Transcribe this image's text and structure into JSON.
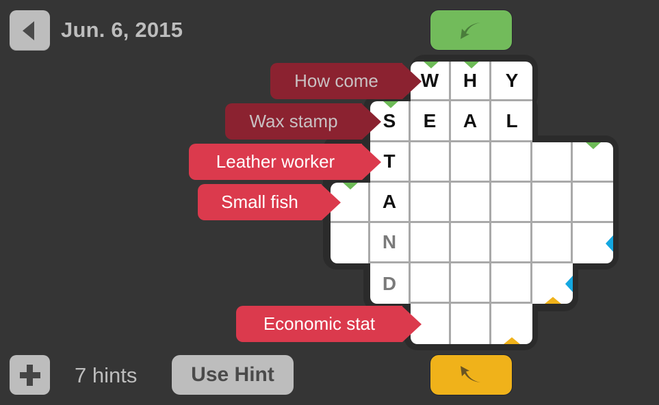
{
  "header": {
    "back_icon": "triangle-left-icon",
    "date": "Jun. 6, 2015"
  },
  "controls": {
    "undo_icon": "curved-arrow-down-left-icon",
    "undo_color": "#72bb5b",
    "redo_icon": "curved-arrow-up-left-icon",
    "redo_color": "#f0b21a"
  },
  "clues": [
    {
      "text": "How come",
      "state": "solved",
      "answer_row": 0
    },
    {
      "text": "Wax stamp",
      "state": "solved",
      "answer_row": 1
    },
    {
      "text": "Leather worker",
      "state": "active",
      "answer_row": 2
    },
    {
      "text": "Small fish",
      "state": "active",
      "answer_row": 3
    },
    {
      "text": "Economic stat",
      "state": "active",
      "answer_row": 6
    }
  ],
  "grid": {
    "rows": [
      {
        "cells": [
          {
            "col": 2,
            "letter": "W",
            "mark": "green-down"
          },
          {
            "col": 3,
            "letter": "H",
            "mark": "green-down"
          },
          {
            "col": 4,
            "letter": "Y"
          }
        ]
      },
      {
        "cells": [
          {
            "col": 1,
            "letter": "S",
            "mark": "green-down"
          },
          {
            "col": 2,
            "letter": "E"
          },
          {
            "col": 3,
            "letter": "A"
          },
          {
            "col": 4,
            "letter": "L"
          }
        ]
      },
      {
        "cells": [
          {
            "col": 1,
            "letter": "T"
          },
          {
            "col": 2,
            "letter": ""
          },
          {
            "col": 3,
            "letter": ""
          },
          {
            "col": 4,
            "letter": ""
          },
          {
            "col": 5,
            "letter": ""
          },
          {
            "col": 6,
            "letter": "",
            "mark": "green-down"
          }
        ]
      },
      {
        "cells": [
          {
            "col": 0,
            "letter": "",
            "mark": "green-down"
          },
          {
            "col": 1,
            "letter": "A"
          },
          {
            "col": 2,
            "letter": ""
          },
          {
            "col": 3,
            "letter": ""
          },
          {
            "col": 4,
            "letter": ""
          },
          {
            "col": 5,
            "letter": ""
          },
          {
            "col": 6,
            "letter": ""
          }
        ]
      },
      {
        "cells": [
          {
            "col": 0,
            "letter": ""
          },
          {
            "col": 1,
            "letter": "N",
            "hint": true
          },
          {
            "col": 2,
            "letter": ""
          },
          {
            "col": 3,
            "letter": ""
          },
          {
            "col": 4,
            "letter": ""
          },
          {
            "col": 5,
            "letter": ""
          },
          {
            "col": 6,
            "letter": "",
            "mark": "blue-left"
          }
        ]
      },
      {
        "cells": [
          {
            "col": 1,
            "letter": "D",
            "hint": true
          },
          {
            "col": 2,
            "letter": ""
          },
          {
            "col": 3,
            "letter": ""
          },
          {
            "col": 4,
            "letter": ""
          },
          {
            "col": 5,
            "letter": "",
            "mark": "blue-left,yellow-up"
          }
        ]
      },
      {
        "cells": [
          {
            "col": 2,
            "letter": ""
          },
          {
            "col": 3,
            "letter": ""
          },
          {
            "col": 4,
            "letter": "",
            "mark": "yellow-up"
          }
        ]
      }
    ]
  },
  "footer": {
    "add_hints_icon": "plus-icon",
    "hints_count": "7 hints",
    "use_hint_label": "Use Hint"
  }
}
